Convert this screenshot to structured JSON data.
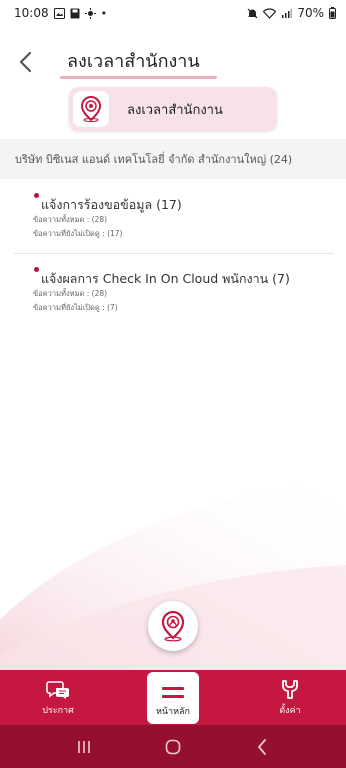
{
  "status_bar": {
    "time": "10:08",
    "battery": "70%"
  },
  "header": {
    "title": "ลงเวลาสำนักงาน"
  },
  "section": {
    "label": "ลงเวลาสำนักงาน"
  },
  "company": {
    "label": "บริษัท บิซิเนส แอนด์ เทคโนโลยี่ จำกัด สำนักงานใหญ่ (24)"
  },
  "items": [
    {
      "title": "แจ้งการร้องขอข้อมูล (17)",
      "total": "ข้อความทั้งหมด : (28)",
      "unread": "ข้อความที่ยังไม่เปิดดู : (17)"
    },
    {
      "title": "แจ้งผลการ Check In On Cloud พนักงาน (7)",
      "total": "ข้อความทั้งหมด : (28)",
      "unread": "ข้อความที่ยังไม่เปิดดู : (7)"
    }
  ],
  "bottom_nav": {
    "announce": "ประกาศ",
    "home": "หน้าหลัก",
    "settings": "ตั้งค่า"
  },
  "colors": {
    "brand": "#c5173f",
    "brand_dark": "#94102e",
    "dot": "#b3123b"
  }
}
